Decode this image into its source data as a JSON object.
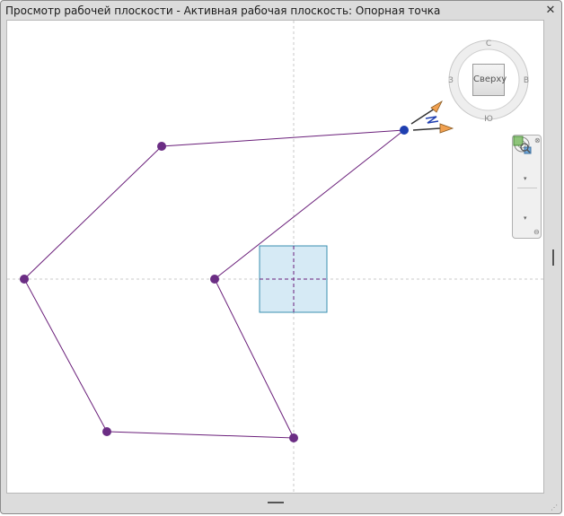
{
  "window": {
    "title": "Просмотр рабочей плоскости - Активная рабочая плоскость: Опорная точка",
    "close_glyph": "✕"
  },
  "viewcube": {
    "face_label": "Сверху"
  },
  "navbar": {
    "close_glyph": "⊗",
    "dropdown_glyph": "▾",
    "options_glyph": "⊖"
  },
  "bottom": {
    "grip_glyph": "⋰"
  },
  "colors": {
    "path_line": "#6a1f7a",
    "vertex": "#6b2d84",
    "selected_vertex": "#1f3fb0",
    "reference_plane": "#d6eaf5",
    "reference_plane_border": "#3a8fb0",
    "arrow": "#f0a050"
  }
}
